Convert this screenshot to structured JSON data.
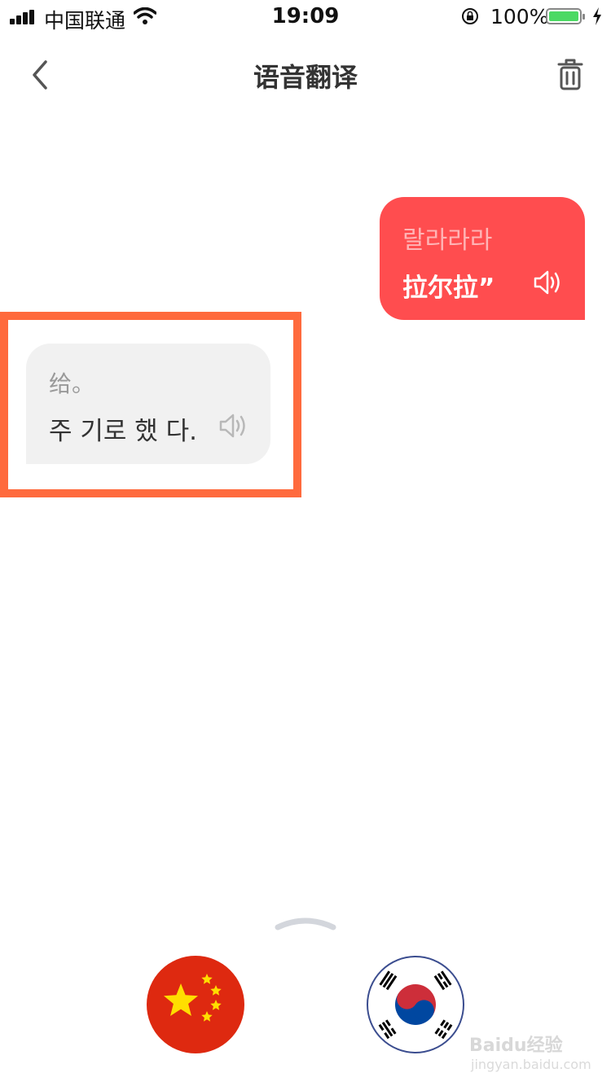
{
  "status_bar": {
    "carrier": "中国联通",
    "time": "19:09",
    "battery_percent": "100%",
    "battery_level": 1.0,
    "battery_color": "#4cd964"
  },
  "header": {
    "title": "语音翻译",
    "back_icon": "chevron-left-icon",
    "delete_icon": "trash-icon"
  },
  "messages": [
    {
      "side": "right",
      "source_text": "랄라라라",
      "translated_text": "拉尔拉”",
      "speaker_icon": "speaker-icon",
      "bubble_color": "#ff4d4f"
    },
    {
      "side": "left",
      "source_text": "给。",
      "translated_text": "주 기로 했 다.",
      "speaker_icon": "speaker-icon",
      "bubble_color": "#f1f1f1",
      "highlight_color": "#ff6a3d"
    }
  ],
  "bottom": {
    "expand_icon": "chevron-up-icon",
    "left_language_flag": "china-flag-icon",
    "right_language_flag": "korea-flag-icon"
  },
  "watermark": {
    "brand": "Baidu经验",
    "url": "jingyan.baidu.com"
  }
}
